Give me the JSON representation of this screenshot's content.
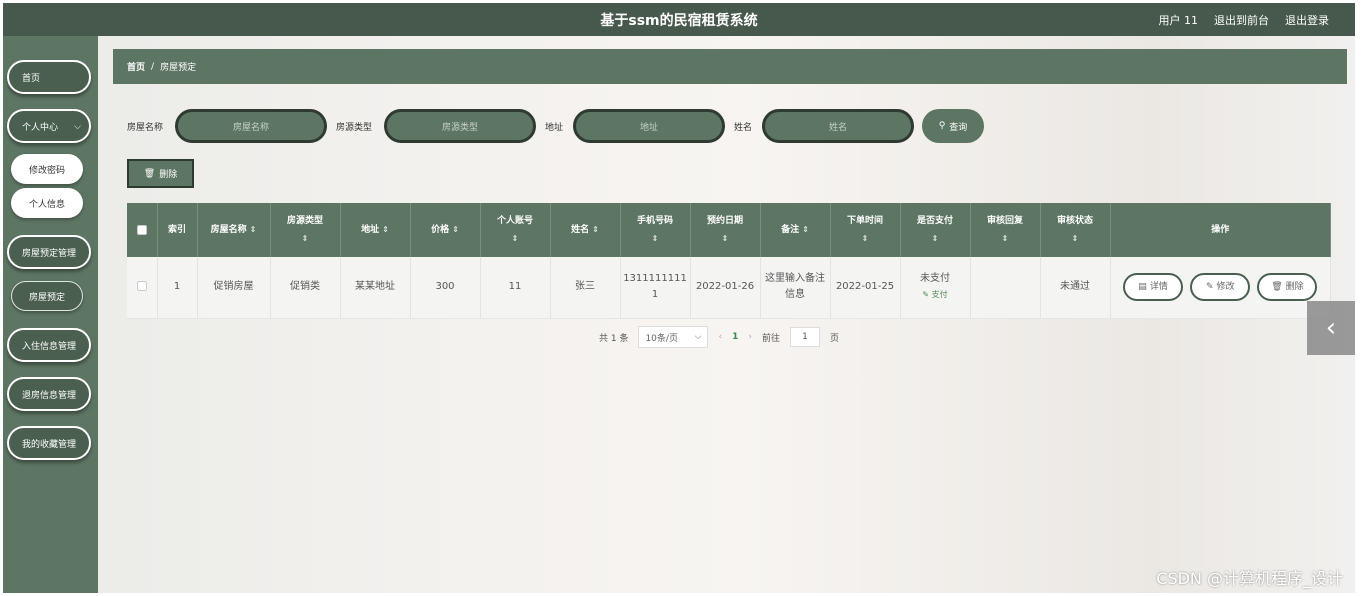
{
  "header": {
    "title": "基于ssm的民宿租赁系统",
    "user": "用户 11",
    "exit_front": "退出到前台",
    "logout": "退出登录"
  },
  "sidebar": {
    "home": "首页",
    "personal_center": "个人中心",
    "change_password": "修改密码",
    "personal_info": "个人信息",
    "booking_mgmt": "房屋预定管理",
    "booking": "房屋预定",
    "checkin_mgmt": "入住信息管理",
    "checkout_mgmt": "退房信息管理",
    "favorites_mgmt": "我的收藏管理"
  },
  "breadcrumb": {
    "home": "首页",
    "separator": "/",
    "current": "房屋预定"
  },
  "search": {
    "house_name_label": "房屋名称",
    "house_name_placeholder": "房屋名称",
    "type_label": "房源类型",
    "type_placeholder": "房源类型",
    "address_label": "地址",
    "address_placeholder": "地址",
    "name_label": "姓名",
    "name_placeholder": "姓名",
    "query_button": "查询"
  },
  "toolbar": {
    "delete_button": "删除"
  },
  "table": {
    "columns": [
      "索引",
      "房屋名称",
      "房源类型",
      "地址",
      "价格",
      "个人账号",
      "姓名",
      "手机号码",
      "预约日期",
      "备注",
      "下单时间",
      "是否支付",
      "审核回复",
      "审核状态",
      "操作"
    ],
    "rows": [
      {
        "index": "1",
        "house_name": "促销房屋",
        "type": "促销类",
        "address": "某某地址",
        "price": "300",
        "account": "11",
        "name": "张三",
        "phone": "13111111111",
        "booking_date": "2022-01-26",
        "remark": "这里输入备注信息",
        "order_time": "2022-01-25",
        "paid": "未支付",
        "pay_action": "支付",
        "review_reply": "",
        "review_status": "未通过",
        "actions": {
          "detail": "详情",
          "edit": "修改",
          "delete": "删除"
        }
      }
    ]
  },
  "pagination": {
    "total": "共 1 条",
    "page_size": "10条/页",
    "current_page": "1",
    "goto_label": "前往",
    "goto_value": "1",
    "page_unit": "页"
  },
  "watermark": "CSDN @计算机程序_设计",
  "colors": {
    "primary": "#5d7563",
    "header": "#47594d"
  }
}
